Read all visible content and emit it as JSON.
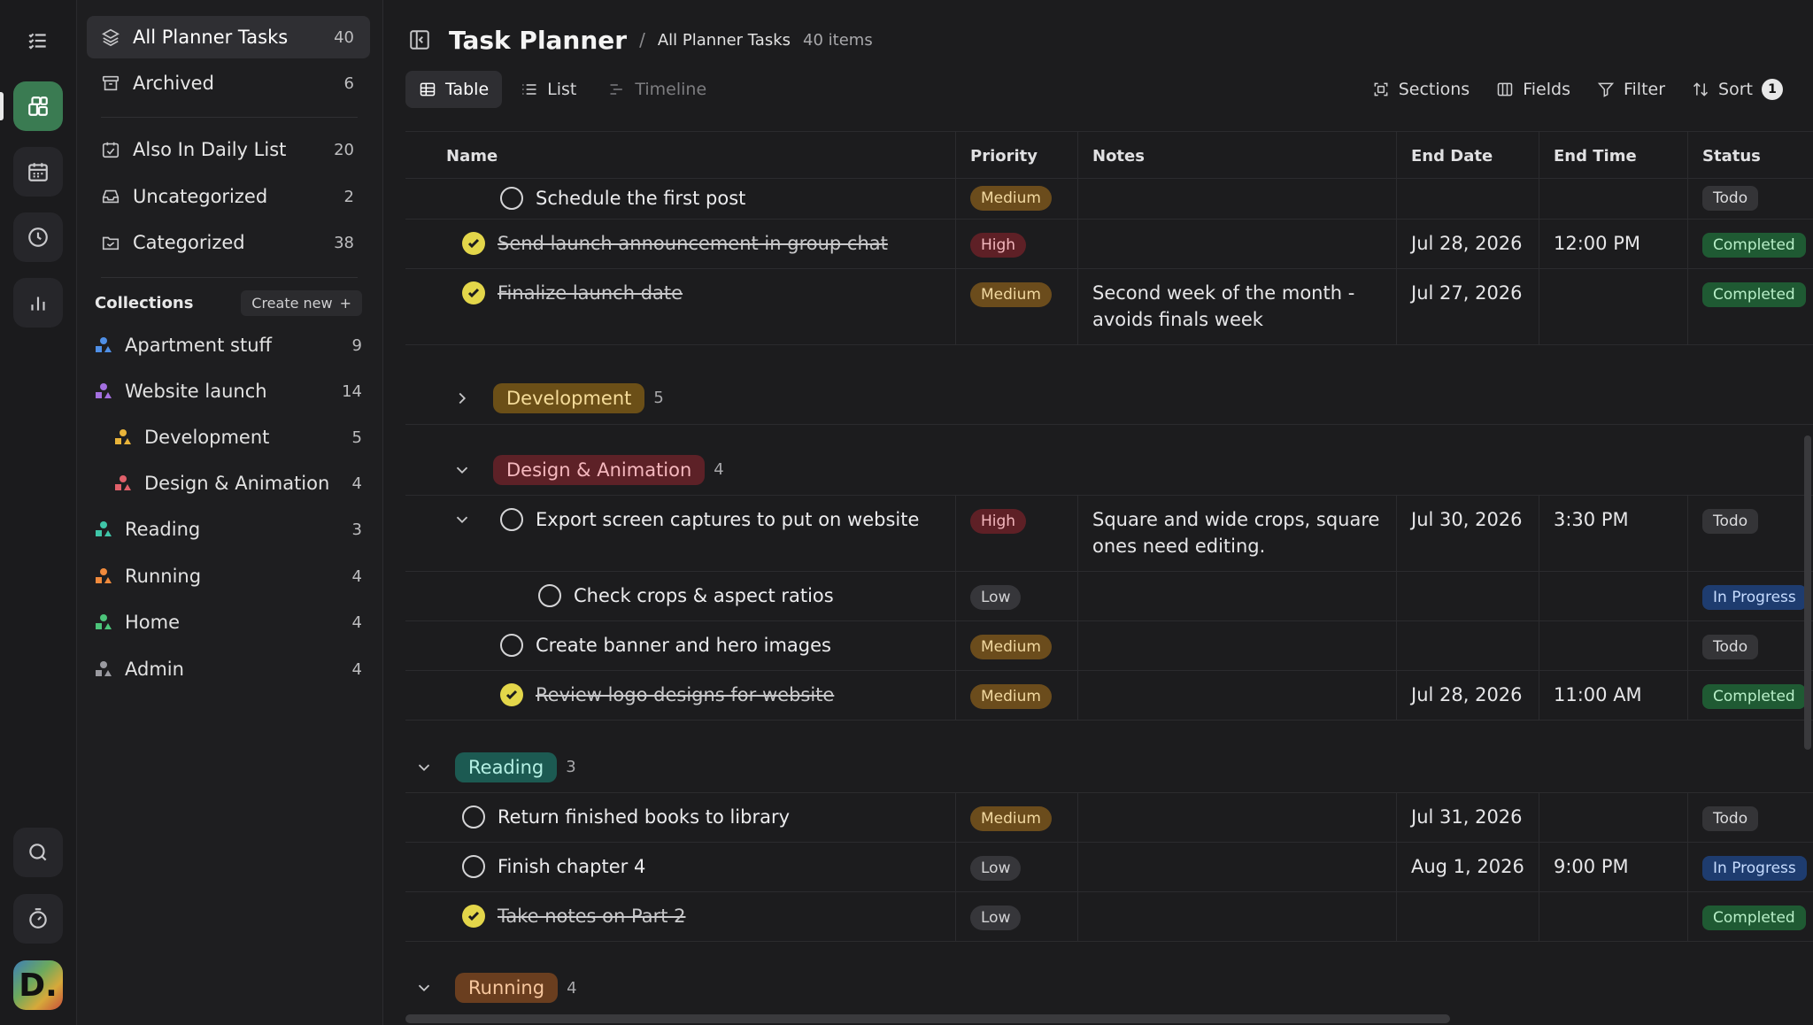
{
  "rail": {
    "icons": [
      "tasks-icon",
      "planner-icon",
      "calendar-icon",
      "clock-icon",
      "stats-icon",
      "search-icon",
      "timer-icon"
    ],
    "avatar_letter": "D."
  },
  "sidebar": {
    "top": [
      {
        "label": "All Planner Tasks",
        "count": "40",
        "icon": "layers-icon"
      },
      {
        "label": "Archived",
        "count": "6",
        "icon": "archive-icon"
      }
    ],
    "lists": [
      {
        "label": "Also In Daily List",
        "count": "20",
        "icon": "calendar-check-icon"
      },
      {
        "label": "Uncategorized",
        "count": "2",
        "icon": "inbox-icon"
      },
      {
        "label": "Categorized",
        "count": "38",
        "icon": "folder-icon"
      }
    ],
    "collections_title": "Collections",
    "create_new": "Create new",
    "collections": [
      {
        "label": "Apartment stuff",
        "count": "9",
        "color": "#4f8fe6"
      },
      {
        "label": "Website launch",
        "count": "14",
        "color": "#a470e0"
      },
      {
        "label": "Development",
        "count": "5",
        "color": "#e9b43a"
      },
      {
        "label": "Design & Animation",
        "count": "4",
        "color": "#e0606a"
      },
      {
        "label": "Reading",
        "count": "3",
        "color": "#3fc6a8"
      },
      {
        "label": "Running",
        "count": "4",
        "color": "#f08a3c"
      },
      {
        "label": "Home",
        "count": "4",
        "color": "#4cc47a"
      },
      {
        "label": "Admin",
        "count": "4",
        "color": "#9a9aa0"
      }
    ]
  },
  "header": {
    "title": "Task Planner",
    "separator": "/",
    "crumb": "All Planner Tasks",
    "count": "40 items"
  },
  "views": {
    "table": "Table",
    "list": "List",
    "timeline": "Timeline"
  },
  "tools": {
    "sections": "Sections",
    "fields": "Fields",
    "filter": "Filter",
    "sort": "Sort",
    "sort_badge": "1"
  },
  "columns": {
    "name": "Name",
    "priority": "Priority",
    "notes": "Notes",
    "end_date": "End Date",
    "end_time": "End Time",
    "status": "Status"
  },
  "rows": {
    "r1": {
      "name": "Schedule the first post",
      "priority": "Medium",
      "notes": "",
      "end_date": "",
      "end_time": "",
      "status": "Todo"
    },
    "r2": {
      "name": "Send launch announcement in group chat",
      "priority": "High",
      "notes": "",
      "end_date": "Jul 28, 2026",
      "end_time": "12:00 PM",
      "status": "Completed"
    },
    "r3": {
      "name": "Finalize launch date",
      "priority": "Medium",
      "notes_line1": "Second week of the month -",
      "notes_line2": "avoids finals week",
      "end_date": "Jul 27, 2026",
      "end_time": "",
      "status": "Completed"
    },
    "g_dev": {
      "label": "Development",
      "count": "5"
    },
    "g_design": {
      "label": "Design & Animation",
      "count": "4"
    },
    "r4": {
      "name": "Export screen captures to put on website",
      "priority": "High",
      "notes_line1": "Square and wide crops, square",
      "notes_line2": "ones need editing.",
      "end_date": "Jul 30, 2026",
      "end_time": "3:30 PM",
      "status": "Todo"
    },
    "r5": {
      "name": "Check crops & aspect ratios",
      "priority": "Low",
      "notes": "",
      "end_date": "",
      "end_time": "",
      "status": "In Progress"
    },
    "r6": {
      "name": "Create banner and hero images",
      "priority": "Medium",
      "notes": "",
      "end_date": "",
      "end_time": "",
      "status": "Todo"
    },
    "r7": {
      "name": "Review logo designs for website",
      "priority": "Medium",
      "notes": "",
      "end_date": "Jul 28, 2026",
      "end_time": "11:00 AM",
      "status": "Completed"
    },
    "g_reading": {
      "label": "Reading",
      "count": "3"
    },
    "r8": {
      "name": "Return finished books to library",
      "priority": "Medium",
      "notes": "",
      "end_date": "Jul 31, 2026",
      "end_time": "",
      "status": "Todo"
    },
    "r9": {
      "name": "Finish chapter 4",
      "priority": "Low",
      "notes": "",
      "end_date": "Aug 1, 2026",
      "end_time": "9:00 PM",
      "status": "In Progress"
    },
    "r10": {
      "name": "Take notes on Part 2",
      "priority": "Low",
      "notes": "",
      "end_date": "",
      "end_time": "",
      "status": "Completed"
    },
    "g_running": {
      "label": "Running",
      "count": "4"
    }
  }
}
